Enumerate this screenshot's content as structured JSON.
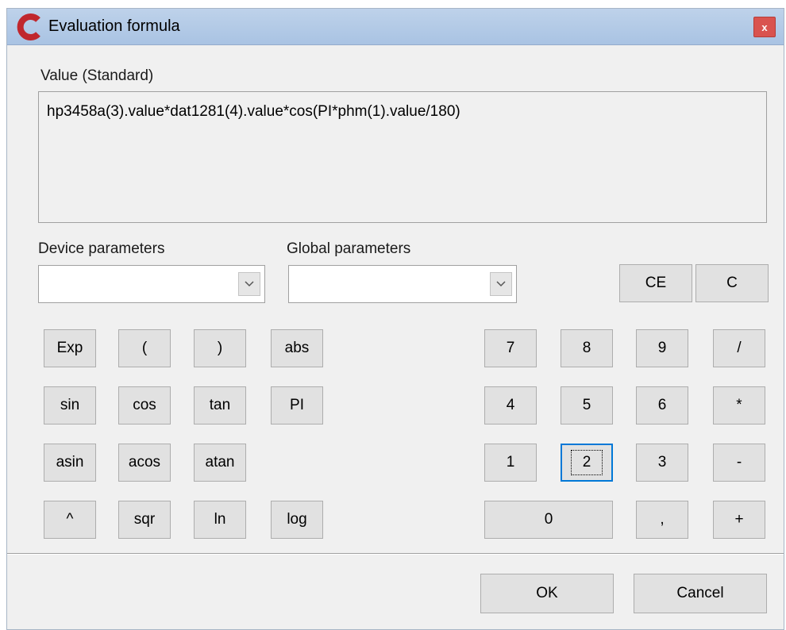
{
  "window": {
    "title": "Evaluation formula",
    "close_label": "x",
    "accent_color": "#c0272d"
  },
  "formula": {
    "label": "Value (Standard)",
    "text": "hp3458a(3).value*dat1281(4).value*cos(PI*phm(1).value/180)"
  },
  "device_params": {
    "label": "Device parameters",
    "value": ""
  },
  "global_params": {
    "label": "Global parameters",
    "value": ""
  },
  "clear_buttons": {
    "ce": "CE",
    "c": "C"
  },
  "function_keys": {
    "exp": "Exp",
    "lparen": "(",
    "rparen": ")",
    "abs": "abs",
    "sin": "sin",
    "cos": "cos",
    "tan": "tan",
    "pi": "PI",
    "asin": "asin",
    "acos": "acos",
    "atan": "atan",
    "pow": "^",
    "sqr": "sqr",
    "ln": "ln",
    "log": "log"
  },
  "numpad": {
    "n7": "7",
    "n8": "8",
    "n9": "9",
    "div": "/",
    "n4": "4",
    "n5": "5",
    "n6": "6",
    "mul": "*",
    "n1": "1",
    "n2": "2",
    "n3": "3",
    "sub": "-",
    "n0": "0",
    "comma": ",",
    "add": "+"
  },
  "footer": {
    "ok": "OK",
    "cancel": "Cancel"
  },
  "icons": {
    "logo": "app-logo-icon",
    "close": "close-icon",
    "dropdown": "chevron-down-icon"
  }
}
